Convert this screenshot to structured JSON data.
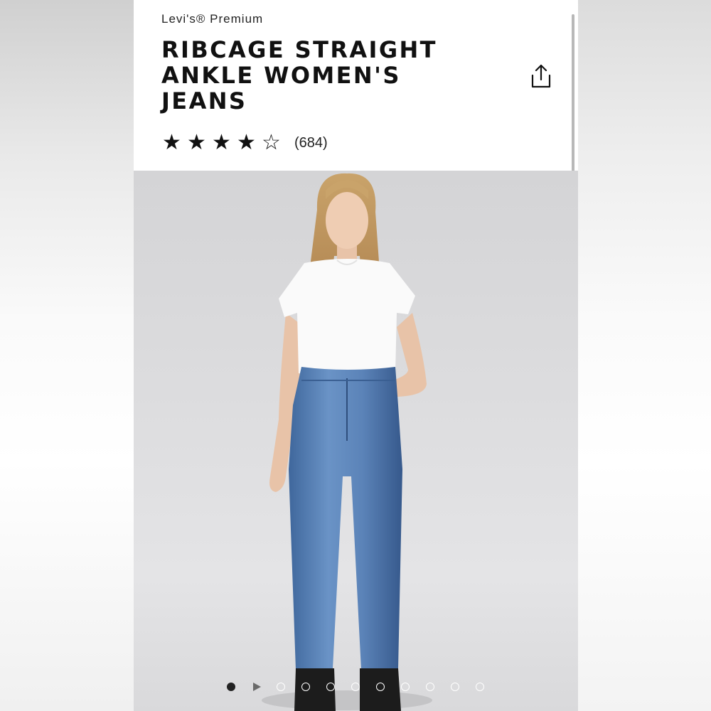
{
  "product": {
    "brand": "Levi's® Premium",
    "title": "RIBCAGE STRAIGHT ANKLE WOMEN'S JEANS",
    "rating": 4,
    "rating_max": 5,
    "review_count": "(684)"
  },
  "icons": {
    "share": "share-icon",
    "star_filled": "star-filled-icon",
    "star_empty": "star-empty-icon"
  },
  "gallery": {
    "image_description": "model-wearing-jeans-photo",
    "total_items": 11,
    "active_index": 0,
    "video_index": 1
  },
  "colors": {
    "background": "#ffffff",
    "text": "#111111",
    "hero_background": "#dcdcde",
    "denim": "#5b83b8"
  }
}
